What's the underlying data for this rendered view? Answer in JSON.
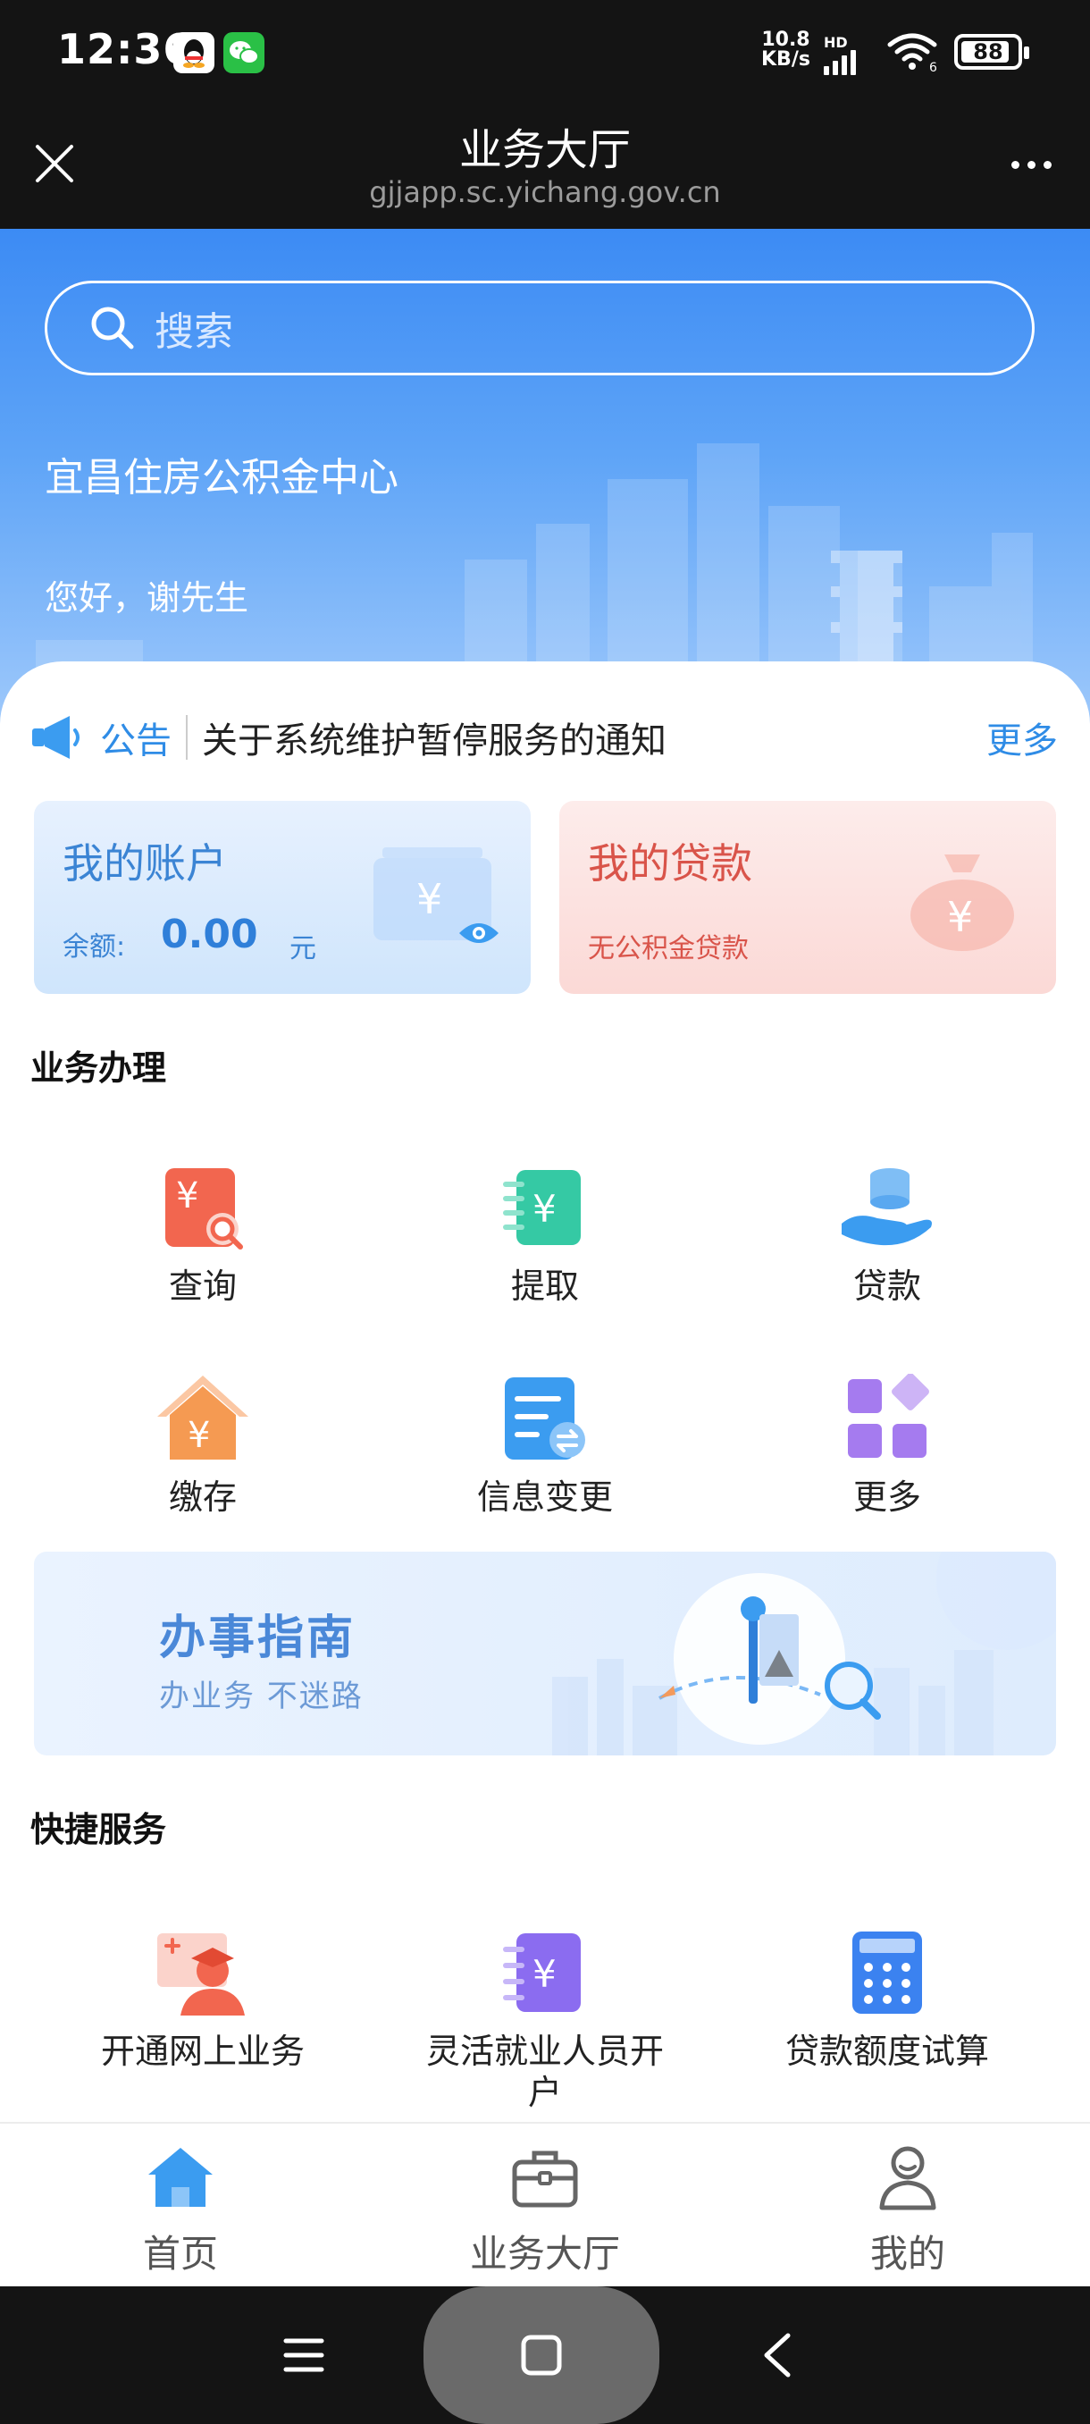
{
  "status_bar": {
    "time": "12:36",
    "net_speed_value": "10.8",
    "net_speed_unit": "KB/s",
    "network_type": "HD",
    "battery": "88",
    "battery_level_percent": 88
  },
  "titlebar": {
    "title": "业务大厅",
    "url": "gjjapp.sc.yichang.gov.cn"
  },
  "hero": {
    "search_placeholder": "搜索",
    "org_name": "宜昌住房公积金中心",
    "greeting": "您好，谢先生"
  },
  "notice": {
    "tag": "公告",
    "text": "关于系统维护暂停服务的通知",
    "more": "更多"
  },
  "account_card": {
    "title": "我的账户",
    "balance_label": "余额:",
    "balance_value": "0.00",
    "balance_unit": "元"
  },
  "loan_card": {
    "title": "我的贷款",
    "subtitle": "无公积金贷款"
  },
  "business": {
    "title": "业务办理",
    "items": [
      {
        "label": "查询"
      },
      {
        "label": "提取"
      },
      {
        "label": "贷款"
      },
      {
        "label": "缴存"
      },
      {
        "label": "信息变更"
      },
      {
        "label": "更多"
      }
    ]
  },
  "guide": {
    "title": "办事指南",
    "subtitle": "办业务 不迷路"
  },
  "quick": {
    "title": "快捷服务",
    "items": [
      {
        "label": "开通网上业务"
      },
      {
        "label": "灵活就业人员开户"
      },
      {
        "label": "贷款额度试算"
      }
    ]
  },
  "tabs": [
    {
      "label": "首页"
    },
    {
      "label": "业务大厅"
    },
    {
      "label": "我的"
    }
  ],
  "colors": {
    "brand_blue": "#3c8bf4",
    "tab_active": "#3b9cf0",
    "loan_red": "#d9544a"
  }
}
